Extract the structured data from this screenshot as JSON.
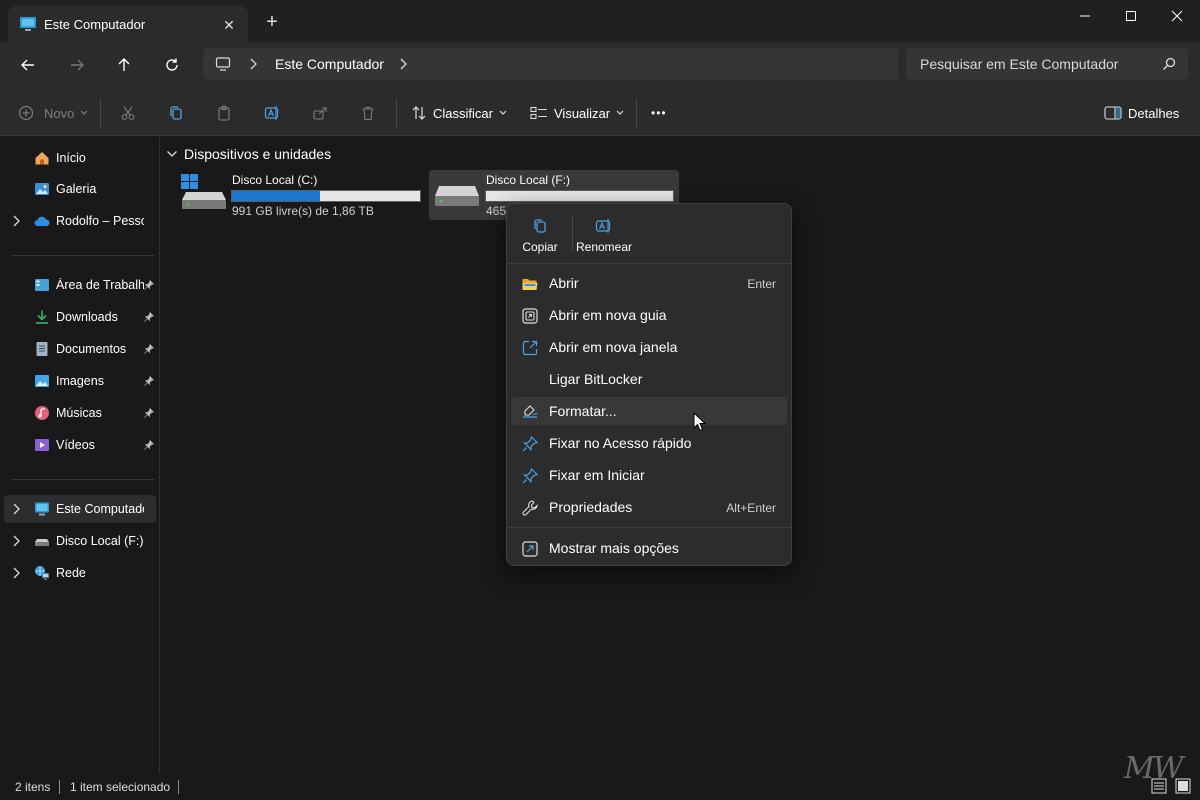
{
  "window": {
    "tab_title": "Este Computador",
    "tab_close": "✕",
    "new_tab": "+"
  },
  "address": {
    "crumb": "Este Computador",
    "search_placeholder": "Pesquisar em Este Computador"
  },
  "command_bar": {
    "new_label": "Novo",
    "sort_label": "Classificar",
    "view_label": "Visualizar",
    "more_label": "•••",
    "details_label": "Detalhes"
  },
  "sidebar": {
    "top": [
      {
        "label": "Início",
        "icon": "home-icon"
      },
      {
        "label": "Galeria",
        "icon": "gallery-icon"
      },
      {
        "label": "Rodolfo – Pessoal",
        "icon": "onedrive-icon"
      }
    ],
    "pinned": [
      {
        "label": "Área de Trabalho",
        "icon": "desktop-icon"
      },
      {
        "label": "Downloads",
        "icon": "downloads-icon"
      },
      {
        "label": "Documentos",
        "icon": "documents-icon"
      },
      {
        "label": "Imagens",
        "icon": "pictures-icon"
      },
      {
        "label": "Músicas",
        "icon": "music-icon"
      },
      {
        "label": "Vídeos",
        "icon": "videos-icon"
      }
    ],
    "devices": [
      {
        "label": "Este Computador",
        "icon": "computer-icon"
      },
      {
        "label": "Disco Local (F:)",
        "icon": "drive-icon"
      },
      {
        "label": "Rede",
        "icon": "network-icon"
      }
    ]
  },
  "content": {
    "section_title": "Dispositivos e unidades",
    "drives": [
      {
        "name": "Disco Local (C:)",
        "info": "991 GB livre(s) de 1,86 TB",
        "used_fraction": 0.47
      },
      {
        "name": "Disco Local (F:)",
        "info": "465",
        "used_fraction": 0.0
      }
    ]
  },
  "context_menu": {
    "copy_label": "Copiar",
    "rename_label": "Renomear",
    "items": [
      {
        "label": "Abrir",
        "shortcut": "Enter",
        "icon": "open-folder-icon"
      },
      {
        "label": "Abrir em nova guia",
        "shortcut": "",
        "icon": "new-tab-icon"
      },
      {
        "label": "Abrir em nova janela",
        "shortcut": "",
        "icon": "new-window-icon"
      },
      {
        "label": "Ligar BitLocker",
        "shortcut": "",
        "icon": ""
      },
      {
        "label": "Formatar...",
        "shortcut": "",
        "icon": "format-icon"
      },
      {
        "label": "Fixar no Acesso rápido",
        "shortcut": "",
        "icon": "pin-icon"
      },
      {
        "label": "Fixar em Iniciar",
        "shortcut": "",
        "icon": "pin-icon"
      },
      {
        "label": "Propriedades",
        "shortcut": "Alt+Enter",
        "icon": "wrench-icon"
      },
      {
        "label": "Mostrar mais opções",
        "shortcut": "",
        "icon": "more-options-icon"
      }
    ]
  },
  "status": {
    "items_count": "2 itens",
    "selected": "1 item selecionado"
  },
  "watermark": "MW",
  "colors": {
    "accent": "#0f6cbd",
    "folder": "#f5c842"
  }
}
